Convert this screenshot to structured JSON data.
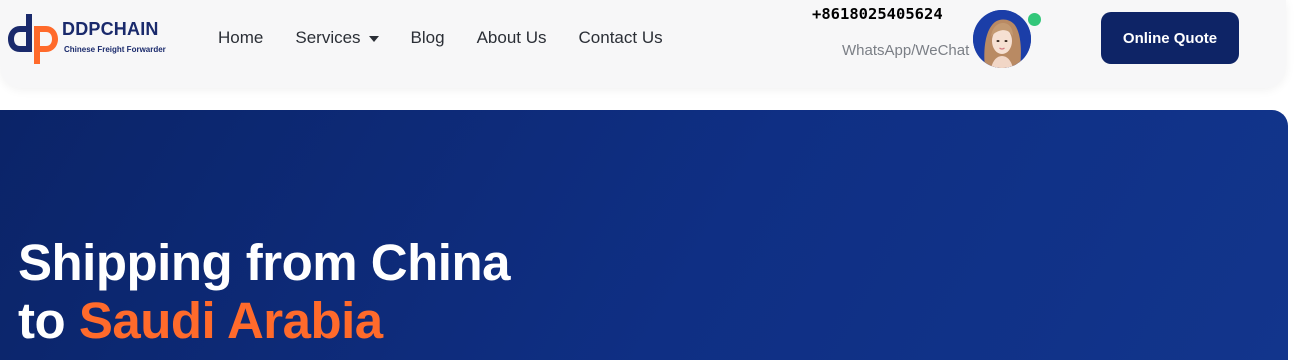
{
  "logo": {
    "name": "DDPCHAIN",
    "tagline": "Chinese Freight Forwarder",
    "colors": {
      "navy": "#1a2a6c",
      "orange": "#ff6a2b"
    }
  },
  "nav": {
    "items": [
      {
        "label": "Home",
        "has_dropdown": false
      },
      {
        "label": "Services",
        "has_dropdown": true
      },
      {
        "label": "Blog",
        "has_dropdown": false
      },
      {
        "label": "About Us",
        "has_dropdown": false
      },
      {
        "label": "Contact Us",
        "has_dropdown": false
      }
    ]
  },
  "contact": {
    "phone": "+8618025405624",
    "channel": "WhatsApp/WeChat",
    "avatar_icon": "agent-avatar",
    "status": "online",
    "status_color": "#33c77a"
  },
  "cta": {
    "label": "Online Quote",
    "color": "#0e2466"
  },
  "hero": {
    "title_line1": "Shipping from China",
    "title_line2_prefix": "to ",
    "title_line2_accent": "Saudi Arabia",
    "background_color": "#0f2f84",
    "accent_color": "#ff6a2b"
  }
}
